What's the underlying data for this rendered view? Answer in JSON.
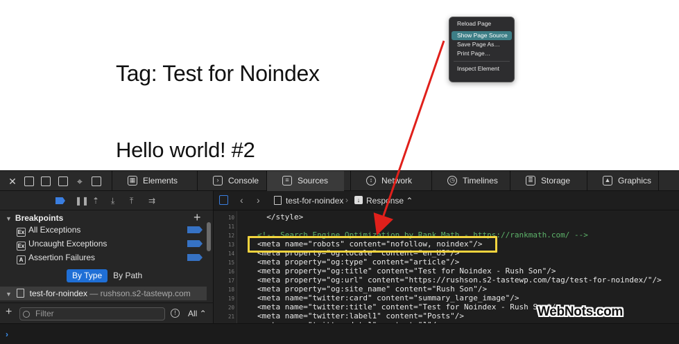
{
  "page": {
    "title": "Tag: Test for Noindex",
    "post_title": "Hello world! #2"
  },
  "context_menu": {
    "items": [
      "Reload Page",
      "Show Page Source",
      "Save Page As…",
      "Print Page…",
      "Inspect Element"
    ],
    "highlighted": "Show Page Source"
  },
  "devtools": {
    "tabs": [
      {
        "label": "Elements",
        "icon": "elements-icon"
      },
      {
        "label": "Console",
        "icon": "console-icon"
      },
      {
        "label": "Sources",
        "icon": "sources-icon",
        "active": true
      },
      {
        "label": "Network",
        "icon": "network-icon"
      },
      {
        "label": "Timelines",
        "icon": "timelines-icon"
      },
      {
        "label": "Storage",
        "icon": "storage-icon"
      },
      {
        "label": "Graphics",
        "icon": "graphics-icon"
      }
    ],
    "sidebar": {
      "breakpoints_title": "Breakpoints",
      "rows": [
        {
          "badge": "Ex",
          "label": "All Exceptions"
        },
        {
          "badge": "Ex",
          "label": "Uncaught Exceptions"
        },
        {
          "badge": "A",
          "label": "Assertion Failures"
        }
      ],
      "segment": {
        "by_type": "By Type",
        "by_path": "By Path"
      },
      "resource": {
        "name": "test-for-noindex",
        "host": " — rushson.s2-tastewp.com"
      },
      "filter_placeholder": "Filter",
      "filter_scope": "All"
    },
    "source": {
      "file": "test-for-noindex",
      "mode": "Response",
      "lines": [
        {
          "n": "10",
          "text": "</style>",
          "indent": "  "
        },
        {
          "n": "11",
          "text": ""
        },
        {
          "n": "12",
          "text": "<!-- Search Engine Optimization by Rank Math - https://rankmath.com/ -->",
          "comment": true
        },
        {
          "n": "13",
          "text": "<meta name=\"robots\" content=\"nofollow, noindex\"/>"
        },
        {
          "n": "14",
          "text": "<meta property=\"og:locale\" content=\"en_US\"/>"
        },
        {
          "n": "15",
          "text": "<meta property=\"og:type\" content=\"article\"/>"
        },
        {
          "n": "16",
          "text": "<meta property=\"og:title\" content=\"Test for Noindex - Rush Son\"/>"
        },
        {
          "n": "17",
          "text": "<meta property=\"og:url\" content=\"https://rushson.s2-tastewp.com/tag/test-for-noindex/\"/>"
        },
        {
          "n": "18",
          "text": "<meta property=\"og:site_name\" content=\"Rush Son\"/>"
        },
        {
          "n": "19",
          "text": "<meta name=\"twitter:card\" content=\"summary_large_image\"/>"
        },
        {
          "n": "20",
          "text": "<meta name=\"twitter:title\" content=\"Test for Noindex - Rush Son\"/>"
        },
        {
          "n": "21",
          "text": "<meta name=\"twitter:label1\" content=\"Posts\"/>"
        },
        {
          "n": "22",
          "text": "<meta name=\"twitter:data1\" content=\"1\"/>"
        }
      ]
    },
    "console_prompt": "›"
  },
  "watermark": "WebNots.com",
  "colors": {
    "accent": "#1f6fd6",
    "highlight_box": "#f3d43e",
    "arrow": "#e0201b",
    "comment": "#5db36a"
  }
}
